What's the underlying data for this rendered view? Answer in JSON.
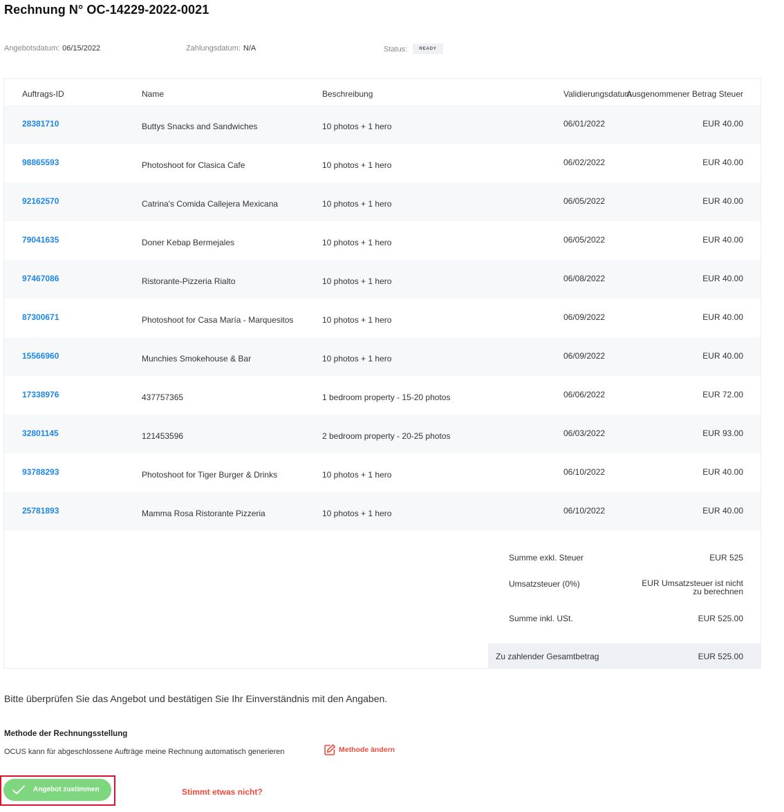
{
  "invoice": {
    "title": "Rechnung N° OC-14229-2022-0021",
    "offer_date_label": "Angebotsdatum:",
    "offer_date": "06/15/2022",
    "payment_date_label": "Zahlungsdatum:",
    "payment_date": "N/A",
    "status_label": "Status:",
    "status": "READY"
  },
  "table": {
    "columns": [
      "Auftrags-ID",
      "Name",
      "Beschreibung",
      "Validierungsdatum",
      "Ausgenommener Betrag Steuer"
    ],
    "rows": [
      {
        "id": "28381710",
        "name": "Buttys Snacks and Sandwiches",
        "description": "10 photos + 1 hero",
        "date": "06/01/2022",
        "amount": "EUR 40.00"
      },
      {
        "id": "98865593",
        "name": "Photoshoot for Clasica Cafe",
        "description": "10 photos + 1 hero",
        "date": "06/02/2022",
        "amount": "EUR 40.00"
      },
      {
        "id": "92162570",
        "name": "Catrina's Comida Callejera Mexicana",
        "description": "10 photos + 1 hero",
        "date": "06/05/2022",
        "amount": "EUR 40.00"
      },
      {
        "id": "79041635",
        "name": "Doner Kebap Bermejales",
        "description": "10 photos + 1 hero",
        "date": "06/05/2022",
        "amount": "EUR 40.00"
      },
      {
        "id": "97467086",
        "name": "Ristorante-Pizzeria Rialto",
        "description": "10 photos + 1 hero",
        "date": "06/08/2022",
        "amount": "EUR 40.00"
      },
      {
        "id": "87300671",
        "name": "Photoshoot for Casa María - Marquesitos",
        "description": "10 photos + 1 hero",
        "date": "06/09/2022",
        "amount": "EUR 40.00"
      },
      {
        "id": "15566960",
        "name": "Munchies Smokehouse & Bar",
        "description": "10 photos + 1 hero",
        "date": "06/09/2022",
        "amount": "EUR 40.00"
      },
      {
        "id": "17338976",
        "name": "437757365",
        "description": "1 bedroom property - 15-20 photos",
        "date": "06/06/2022",
        "amount": "EUR 72.00"
      },
      {
        "id": "32801145",
        "name": "121453596",
        "description": "2 bedroom property - 20-25 photos",
        "date": "06/03/2022",
        "amount": "EUR 93.00"
      },
      {
        "id": "93788293",
        "name": "Photoshoot for Tiger Burger & Drinks",
        "description": "10 photos + 1 hero",
        "date": "06/10/2022",
        "amount": "EUR 40.00"
      },
      {
        "id": "25781893",
        "name": "Mamma Rosa Ristorante Pizzeria",
        "description": "10 photos + 1 hero",
        "date": "06/10/2022",
        "amount": "EUR 40.00"
      }
    ]
  },
  "summary": {
    "subtotal_label": "Summe exkl. Steuer",
    "subtotal": "EUR 525",
    "vat_label": "Umsatzsteuer (0%)",
    "vat_line1": "EUR Umsatzsteuer ist nicht",
    "vat_line2": "zu berechnen",
    "total_incl_label": "Summe inkl. USt.",
    "total_incl": "EUR 525.00",
    "payable_label": "Zu zahlender Gesamtbetrag",
    "payable": "EUR 525.00"
  },
  "notice": "Bitte überprüfen Sie das Angebot und bestätigen Sie Ihr Einverständnis mit den Angaben.",
  "method": {
    "title": "Methode der Rechnungsstellung",
    "description": "OCUS kann für abgeschlossene Aufträge meine Rechnung automatisch generieren",
    "change_label": "Methode ändern"
  },
  "actions": {
    "accept_label": "Angebot zustimmen",
    "wrong_label": "Stimmt etwas nicht?"
  },
  "colors": {
    "link_blue": "#1f87e5",
    "accent_red": "#ef4b3a",
    "accept_green": "#7ed67f",
    "highlight_red": "#e0112f"
  },
  "icons": {
    "accept": "checkmark-icon",
    "change_method": "edit-icon"
  }
}
